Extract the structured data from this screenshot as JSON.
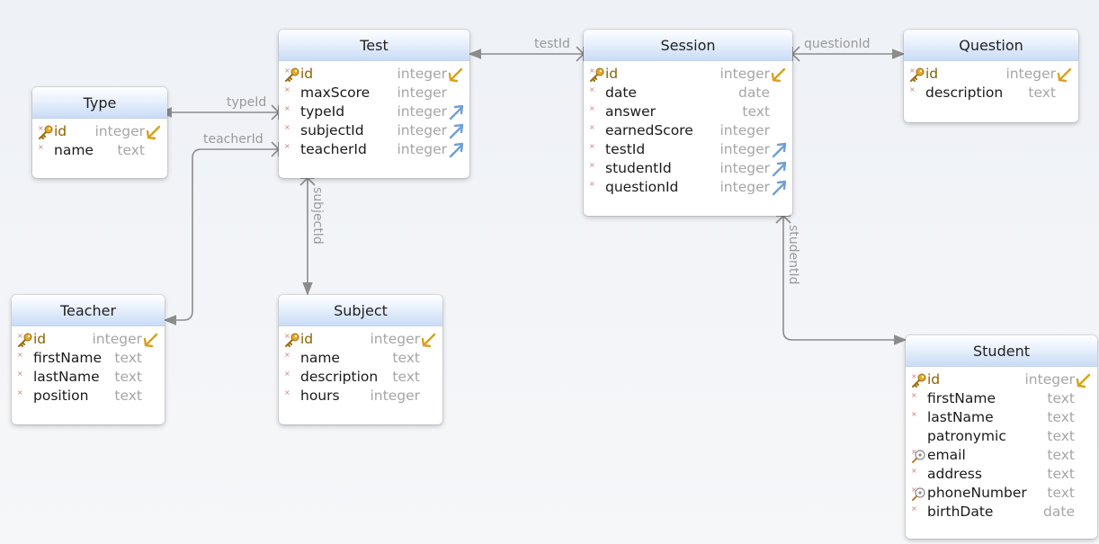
{
  "entities": {
    "test": {
      "title": "Test",
      "fields": [
        {
          "name": "id",
          "type": "integer"
        },
        {
          "name": "maxScore",
          "type": "integer"
        },
        {
          "name": "typeId",
          "type": "integer"
        },
        {
          "name": "subjectId",
          "type": "integer"
        },
        {
          "name": "teacherId",
          "type": "integer"
        }
      ]
    },
    "session": {
      "title": "Session",
      "fields": [
        {
          "name": "id",
          "type": "integer"
        },
        {
          "name": "date",
          "type": "date"
        },
        {
          "name": "answer",
          "type": "text"
        },
        {
          "name": "earnedScore",
          "type": "integer"
        },
        {
          "name": "testId",
          "type": "integer"
        },
        {
          "name": "studentId",
          "type": "integer"
        },
        {
          "name": "questionId",
          "type": "integer"
        }
      ]
    },
    "question": {
      "title": "Question",
      "fields": [
        {
          "name": "id",
          "type": "integer"
        },
        {
          "name": "description",
          "type": "text"
        }
      ]
    },
    "type": {
      "title": "Type",
      "fields": [
        {
          "name": "id",
          "type": "integer"
        },
        {
          "name": "name",
          "type": "text"
        }
      ]
    },
    "teacher": {
      "title": "Teacher",
      "fields": [
        {
          "name": "id",
          "type": "integer"
        },
        {
          "name": "firstName",
          "type": "text"
        },
        {
          "name": "lastName",
          "type": "text"
        },
        {
          "name": "position",
          "type": "text"
        }
      ]
    },
    "subject": {
      "title": "Subject",
      "fields": [
        {
          "name": "id",
          "type": "integer"
        },
        {
          "name": "name",
          "type": "text"
        },
        {
          "name": "description",
          "type": "text"
        },
        {
          "name": "hours",
          "type": "integer"
        }
      ]
    },
    "student": {
      "title": "Student",
      "fields": [
        {
          "name": "id",
          "type": "integer"
        },
        {
          "name": "firstName",
          "type": "text"
        },
        {
          "name": "lastName",
          "type": "text"
        },
        {
          "name": "patronymic",
          "type": "text"
        },
        {
          "name": "email",
          "type": "text"
        },
        {
          "name": "address",
          "type": "text"
        },
        {
          "name": "phoneNumber",
          "type": "text"
        },
        {
          "name": "birthDate",
          "type": "date"
        }
      ]
    }
  },
  "links": {
    "typeId": "typeId",
    "teacherId": "teacherId",
    "subjectId": "subjectId",
    "testId": "testId",
    "questionId": "questionId",
    "studentId": "studentId"
  },
  "colors": {
    "header_gradient_bottom": "#c9dcf6",
    "primary_key_text": "#8a6200",
    "foreign_key_arrow": "#6f9fd8",
    "type_text": "#a6a6a6",
    "link_line": "#8c8c8c"
  },
  "icons": {
    "primary_key": "key-icon",
    "foreign_key": "fk-arrow-icon",
    "unique": "unique-index-icon",
    "not_null": "not-null-marker"
  }
}
